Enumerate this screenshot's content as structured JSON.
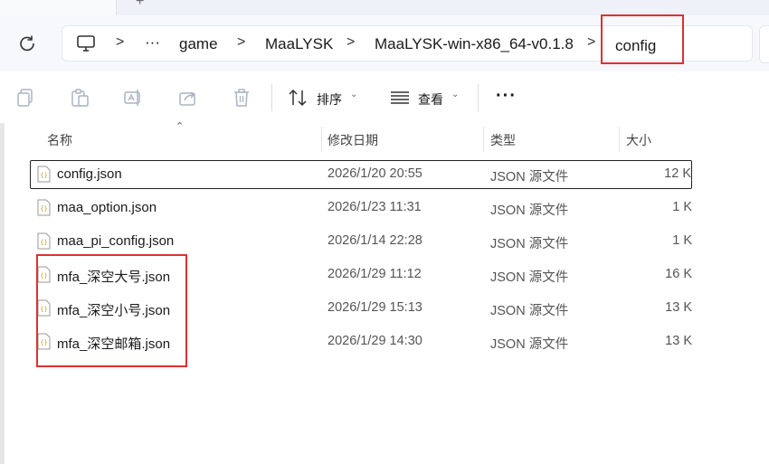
{
  "address": {
    "crumbs": [
      "game",
      "MaaLYSK",
      "MaaLYSK-win-x86_64-v0.1.8",
      "config"
    ],
    "ellipsis": "···",
    "separator": ">"
  },
  "toolbar": {
    "sort_label": "排序",
    "view_label": "查看",
    "more_label": "···"
  },
  "columns": {
    "name": "名称",
    "modified": "修改日期",
    "type": "类型",
    "size": "大小"
  },
  "files": [
    {
      "name": "config.json",
      "modified": "2026/1/20 20:55",
      "type": "JSON 源文件",
      "size": "12 K"
    },
    {
      "name": "maa_option.json",
      "modified": "2026/1/23 11:31",
      "type": "JSON 源文件",
      "size": "1 K"
    },
    {
      "name": "maa_pi_config.json",
      "modified": "2026/1/14 22:28",
      "type": "JSON 源文件",
      "size": "1 K"
    },
    {
      "name": "mfa_深空大号.json",
      "modified": "2026/1/29 11:12",
      "type": "JSON 源文件",
      "size": "16 K"
    },
    {
      "name": "mfa_深空小号.json",
      "modified": "2026/1/29 15:13",
      "type": "JSON 源文件",
      "size": "13 K"
    },
    {
      "name": "mfa_深空邮箱.json",
      "modified": "2026/1/29 14:30",
      "type": "JSON 源文件",
      "size": "13 K"
    }
  ],
  "colors": {
    "highlight": "#e03030",
    "icon_yellow": "#c9a227"
  }
}
